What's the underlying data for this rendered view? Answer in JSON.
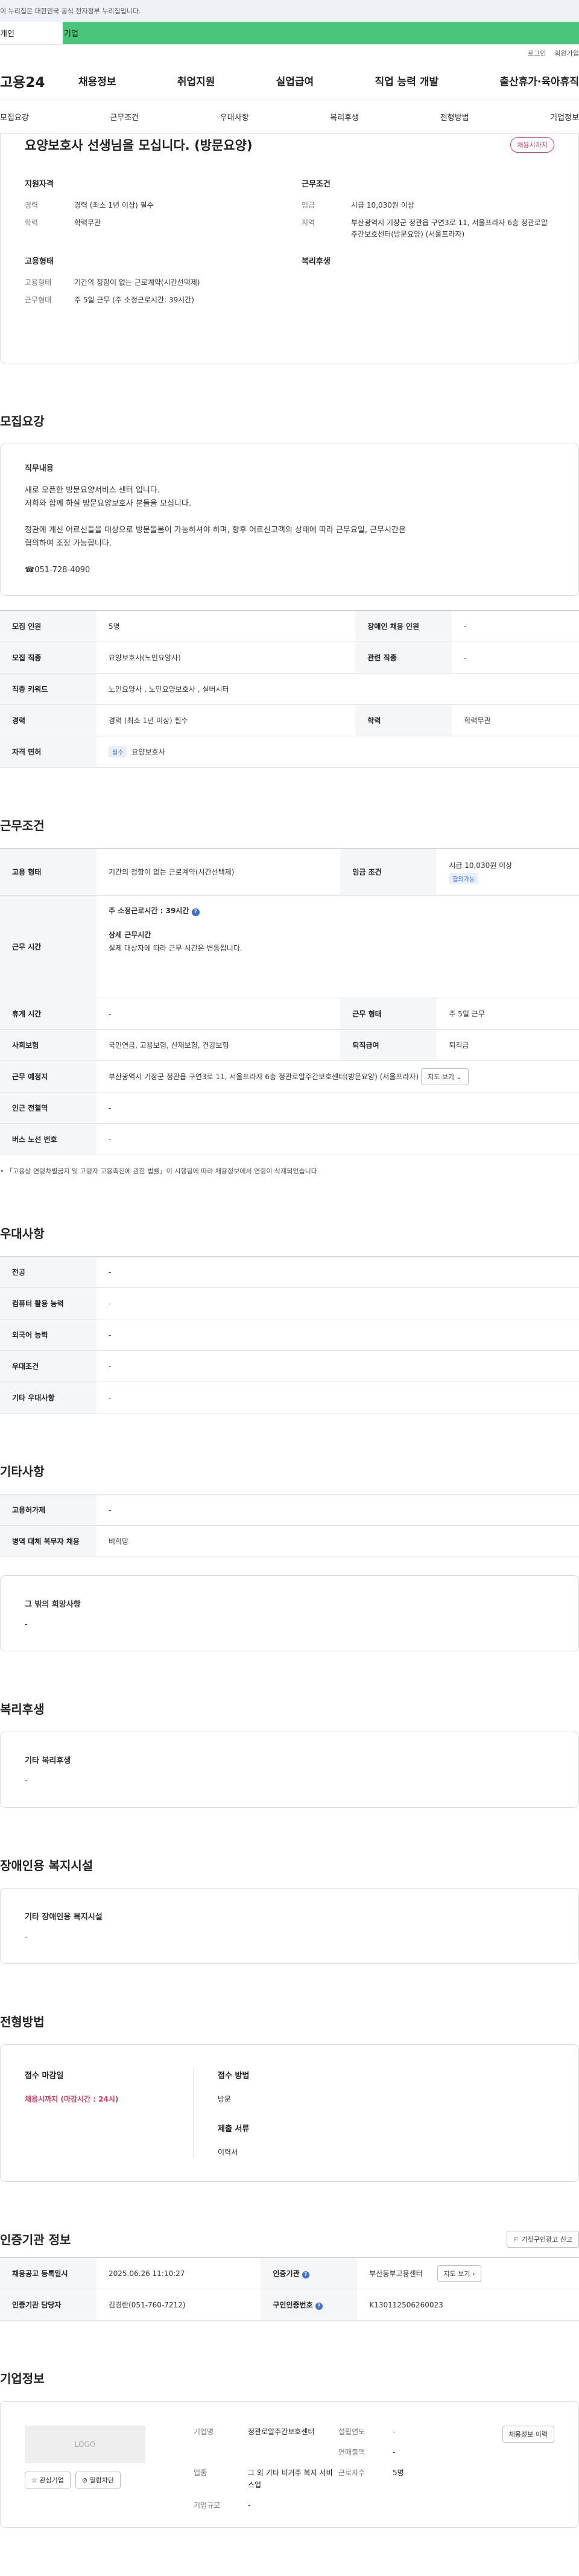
{
  "gov_notice": "이 누리집은 대한민국 공식 전자정부 누리집입니다.",
  "top_tabs": {
    "personal": "개인",
    "company": "기업"
  },
  "util": {
    "login": "로그인",
    "join": "회원가입"
  },
  "gnb": {
    "logo": "고용24",
    "menu": [
      "채용정보",
      "취업지원",
      "실업급여",
      "직업 능력 개발",
      "출산휴가·육아휴직"
    ]
  },
  "anchors": [
    "모집요강",
    "근무조건",
    "우대사항",
    "복리후생",
    "전형방법",
    "기업정보"
  ],
  "summary": {
    "title": "요양보호사 선생님을 모십니다. (방문요양)",
    "deadline_badge": "채용시까지",
    "qual_h": "지원자격",
    "career_k": "경력",
    "career_v": "경력 (최소 1년 이상) 필수",
    "edu_k": "학력",
    "edu_v": "학력무관",
    "cond_h": "근무조건",
    "wage_k": "임금",
    "wage_v": "시급 10,030원 이상",
    "region_k": "지역",
    "region_v": "부산광역시 기장군 정관읍 구연3로 11, 서울프라자 6층 정관로알주간보호센터(방문요양) (서울프라자)",
    "emp_h": "고용형태",
    "emptype_k": "고용형태",
    "emptype_v": "기간의 정함이 없는 근로계약(시간선택제)",
    "worktype_k": "근무형태",
    "worktype_v": "주 5일 근무 (주 소정근로시간: 39시간)",
    "welfare_h": "복리후생"
  },
  "recruit": {
    "heading": "모집요강",
    "duty_h": "직무내용",
    "duty_lines": [
      "새로 오픈한 방문요양서비스 센터 입니다.",
      "저희와 함께 하실 방문요양보호사 분들을 모십니다.",
      "",
      "정관에 계신 어르신들을 대상으로 방문돌봄이 가능하셔야 하며, 향후 어르신고객의 상태에 따라 근무요일, 근무시간은",
      "협의하여 조정 가능합니다.",
      "",
      "☎051-728-4090"
    ],
    "rows": [
      [
        "모집 인원",
        "5명",
        "장애인 채용 인원",
        "-"
      ],
      [
        "모집 직종",
        "요양보호사(노인요양사)",
        "관련 직종",
        "-"
      ],
      [
        "직종 키워드",
        "노인요양사 , 노인요양보호사 , 실버시터"
      ],
      [
        "경력",
        "경력 (최소 1년 이상) 필수",
        "학력",
        "학력무관"
      ],
      [
        "자격 면허",
        "요양보호사"
      ]
    ],
    "license_badge": "필수"
  },
  "work": {
    "heading": "근무조건",
    "emp_k": "고용 형태",
    "emp_v": "기간의 정함이 없는 근로계약(시간선택제)",
    "wage_k": "임금 조건",
    "wage_v": "시급 10,030원 이상",
    "wage_badge": "협의가능",
    "hours_k": "근무 시간",
    "hours_main": "주 소정근로시간 : 39시간",
    "hours_sub_h": "상세 근무시간",
    "hours_sub": "실제 대상자에 따라 근무 시간은 변동됩니다.",
    "rest_k": "휴게 시간",
    "rest_v": "-",
    "form_k": "근무 형태",
    "form_v": "주 5일 근무",
    "ins_k": "사회보험",
    "ins_v": "국민연금, 고용보험, 산재보험, 건강보험",
    "ret_k": "퇴직급여",
    "ret_v": "퇴직금",
    "place_k": "근무 예정지",
    "place_v": "부산광역시 기장군 정관읍 구연3로 11, 서울프라자 6층 정관로알주간보호센터(방문요양) (서울프라자)",
    "map_btn": "지도 보기",
    "sub_k": "인근 전철역",
    "sub_v": "-",
    "bus_k": "버스 노선 번호",
    "bus_v": "-",
    "footnote": "• 「고용상 연령차별금지 및 고령자 고용촉진에 관한 법률」이 시행됨에 따라 채용정보에서 연령이 삭제되었습니다."
  },
  "pref": {
    "heading": "우대사항",
    "rows": [
      [
        "전공",
        "-"
      ],
      [
        "컴퓨터 활용 능력",
        "-"
      ],
      [
        "외국어 능력",
        "-"
      ],
      [
        "우대조건",
        "-"
      ],
      [
        "기타 우대사항",
        "-"
      ]
    ]
  },
  "etc": {
    "heading": "기타사항",
    "rows": [
      [
        "고용허가제",
        "-"
      ],
      [
        "병역 대체 복무자 채용",
        "비희망"
      ]
    ],
    "hope_h": "그 밖의 희망사항",
    "hope_v": "-"
  },
  "welfare": {
    "heading": "복리후생",
    "h": "기타 복리후생",
    "v": "-"
  },
  "disabled": {
    "heading": "장애인용 복지시설",
    "h": "기타 장애인용 복지시설",
    "v": "-"
  },
  "process": {
    "heading": "전형방법",
    "deadline_h": "접수 마감일",
    "deadline_v": "채용시까지 (마감시간 : 24시)",
    "method_h": "접수 방법",
    "method_v": "방문",
    "docs_h": "제출 서류",
    "docs_v": "이력서"
  },
  "agency": {
    "heading": "인증기관 정보",
    "report_btn": "거짓구인광고 신고",
    "r1": [
      "채용공고 등록일시",
      "2025.06.26 11:10:27",
      "인증기관",
      "부산동부고용센터"
    ],
    "r2": [
      "인증기관 담당자",
      "김경란(051-760-7212)",
      "구인인증번호",
      "K130112506260023"
    ],
    "map_btn": "지도 보기"
  },
  "company": {
    "heading": "기업정보",
    "logo": "LOGO",
    "fav_btn": "관심기업",
    "block_btn": "열람차단",
    "jobs_btn": "채용정보 이력",
    "name_k": "기업명",
    "name_v": "정관로알주간보호센터",
    "year_k": "설립연도",
    "year_v": "-",
    "sales_k": "연매출액",
    "sales_v": "-",
    "ind_k": "업종",
    "ind_v": "그 외 기타 비거주 복지 서비스업",
    "emp_k": "근로자수",
    "emp_v": "5명",
    "size_k": "기업규모",
    "size_v": "-"
  }
}
